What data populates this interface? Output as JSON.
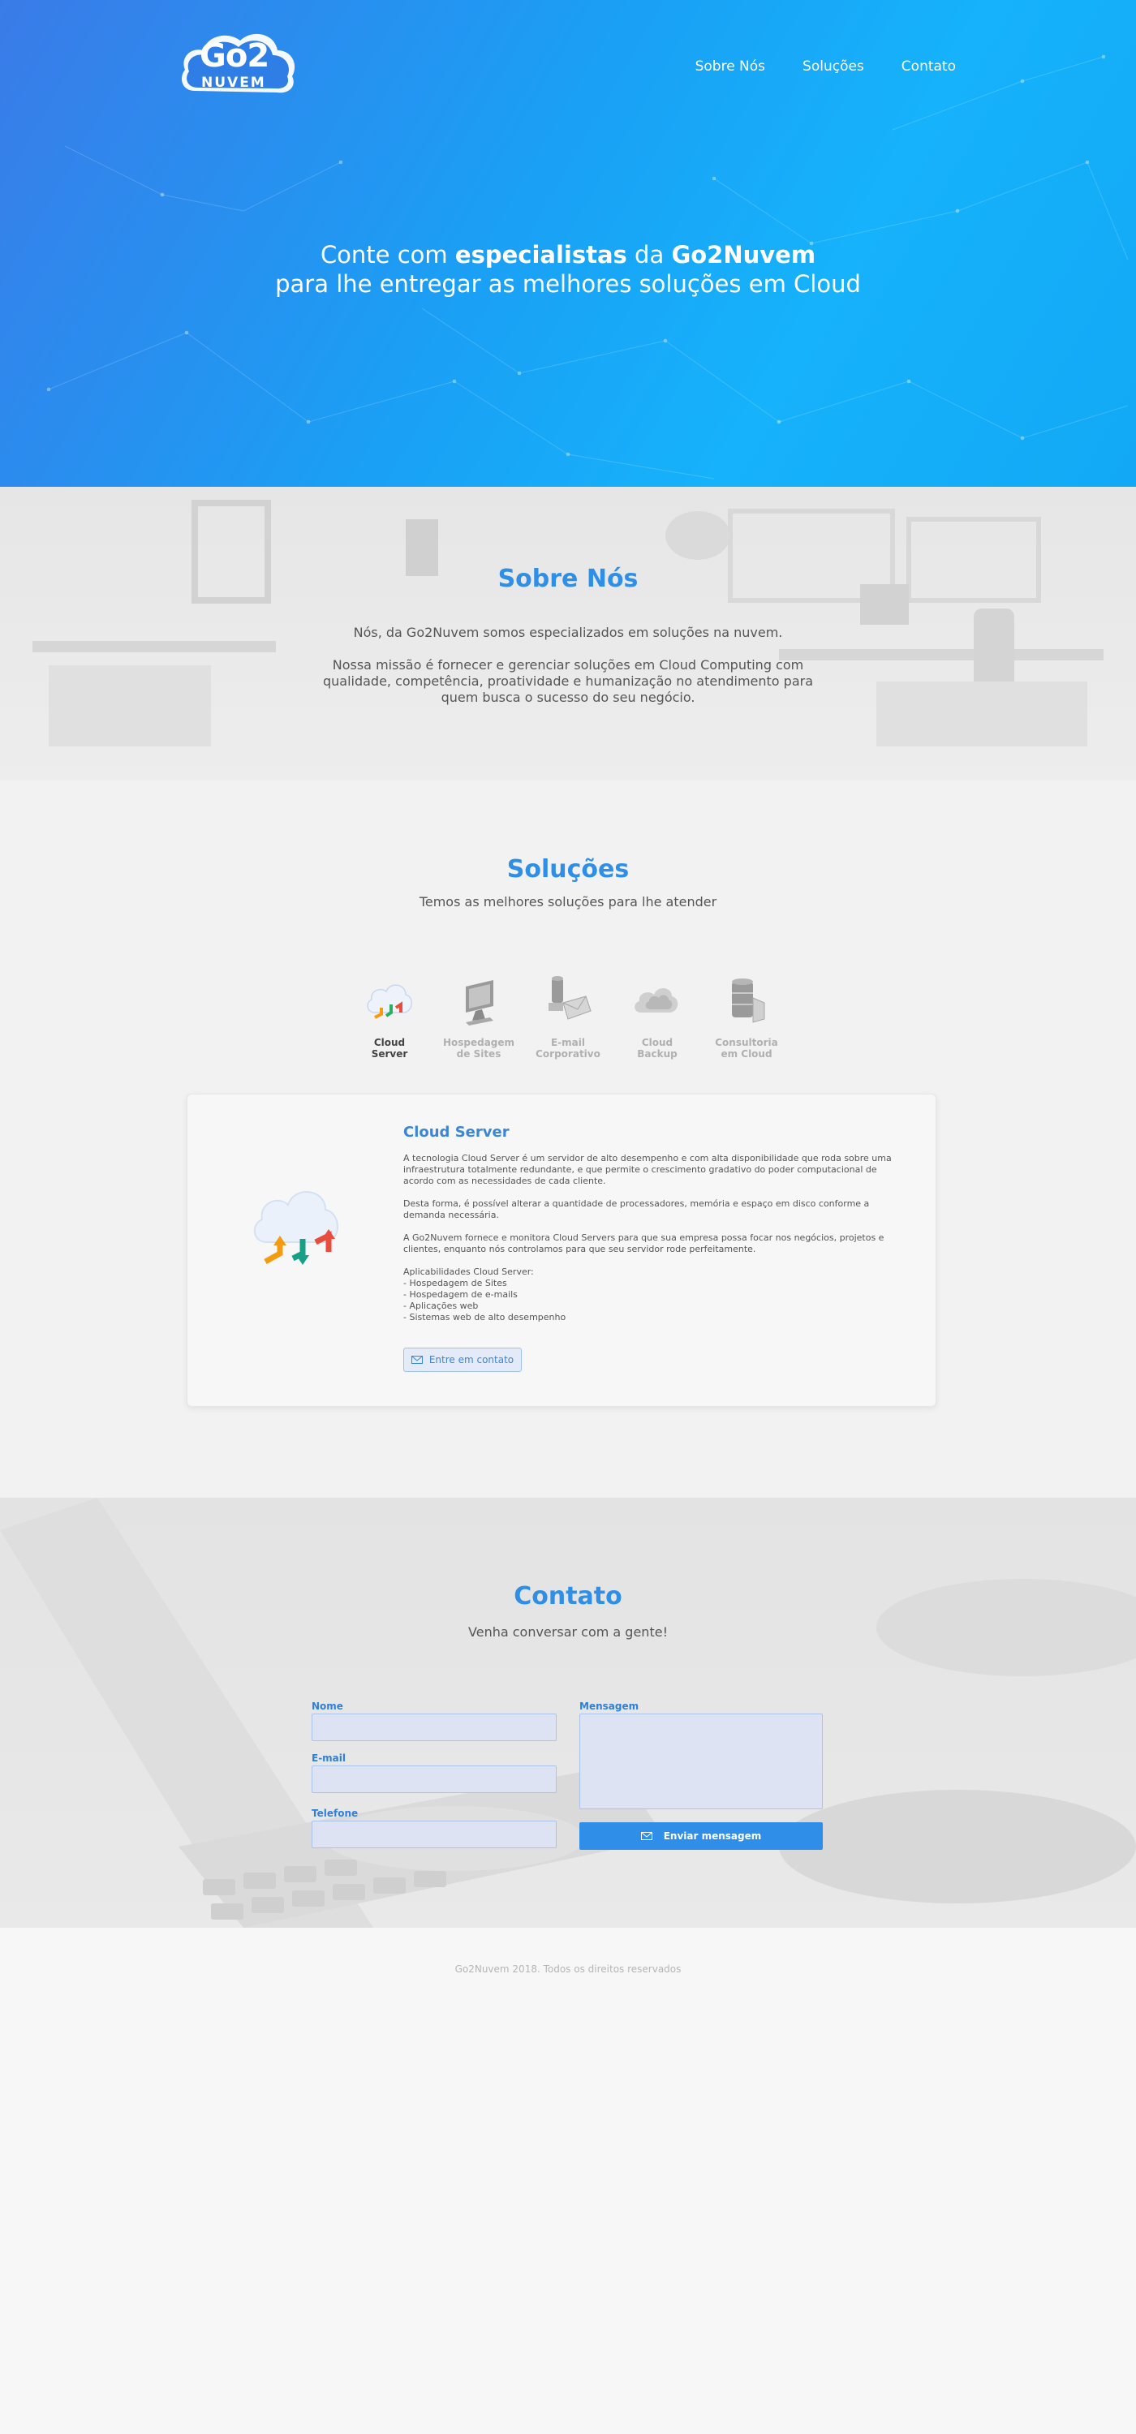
{
  "header": {
    "logo_text_top": "Go2",
    "logo_text_bottom": "NUVEM",
    "nav": [
      {
        "label": "Sobre Nós"
      },
      {
        "label": "Soluções"
      },
      {
        "label": "Contato"
      }
    ]
  },
  "hero": {
    "line1_pre": "Conte com ",
    "line1_bold1": "especialistas",
    "line1_mid": " da ",
    "line1_bold2": "Go2Nuvem",
    "line2": "para lhe entregar as melhores soluções em Cloud"
  },
  "about": {
    "title": "Sobre Nós",
    "paragraph1": "Nós, da Go2Nuvem somos especializados em soluções na nuvem.",
    "paragraph2": "Nossa missão é fornecer e gerenciar soluções em Cloud Computing com qualidade, competência, proatividade e humanização no atendimento para quem busca o sucesso do seu negócio."
  },
  "solutions": {
    "title": "Soluções",
    "subtitle": "Temos as melhores soluções para lhe atender",
    "tabs": [
      {
        "label": "Cloud\nServer",
        "icon": "cloud-server-icon",
        "active": true
      },
      {
        "label": "Hospedagem\nde Sites",
        "icon": "monitor-icon",
        "active": false
      },
      {
        "label": "E-mail\nCorporativo",
        "icon": "email-server-icon",
        "active": false
      },
      {
        "label": "Cloud\nBackup",
        "icon": "cloud-backup-icon",
        "active": false
      },
      {
        "label": "Consultoria\nem Cloud",
        "icon": "database-icon",
        "active": false
      }
    ],
    "card": {
      "title": "Cloud Server",
      "p1": "A tecnologia Cloud Server é um servidor de alto desempenho e com alta disponibilidade que roda sobre uma infraestrutura totalmente redundante, e que permite o crescimento gradativo do poder computacional de acordo com as necessidades de cada cliente.",
      "p2": "Desta forma, é possível alterar a quantidade de processadores, memória e espaço em disco conforme a demanda necessária.",
      "p3": "A Go2Nuvem fornece e monitora Cloud Servers para que sua empresa possa focar nos negócios, projetos e clientes, enquanto nós controlamos para que seu servidor rode perfeitamente.",
      "list_title": "Aplicabilidades Cloud Server:",
      "list": [
        "- Hospedagem de Sites",
        "- Hospedagem de e-mails",
        "- Aplicações web",
        "- Sistemas web de alto desempenho"
      ],
      "button_label": "Entre em contato"
    }
  },
  "contact": {
    "title": "Contato",
    "subtitle": "Venha conversar com a gente!",
    "name_label": "Nome",
    "email_label": "E-mail",
    "phone_label": "Telefone",
    "message_label": "Mensagem",
    "send_label": "Enviar mensagem"
  },
  "footer": {
    "text": "Go2Nuvem 2018. Todos os direitos reservados"
  },
  "colors": {
    "accent": "#2f8fe6",
    "hero_start": "#3a7be8",
    "hero_end": "#16b2fb"
  }
}
